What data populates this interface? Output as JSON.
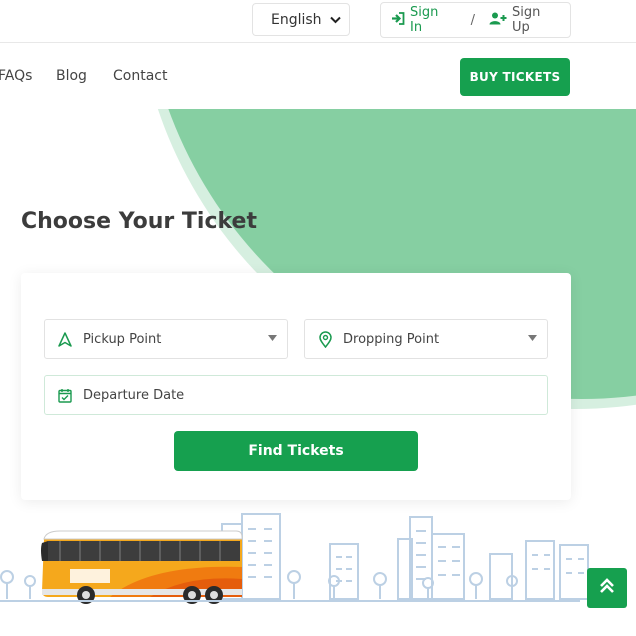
{
  "topbar": {
    "language": "English",
    "sign_in": "Sign In",
    "separator": "/",
    "sign_up": "Sign Up"
  },
  "nav": {
    "links": [
      "FAQs",
      "Blog",
      "Contact"
    ],
    "buy_tickets": "BUY TICKETS"
  },
  "hero": {
    "title": "Choose Your Ticket"
  },
  "search": {
    "pickup_placeholder": "Pickup Point",
    "dropping_placeholder": "Dropping Point",
    "date_placeholder": "Departure Date",
    "find_button": "Find Tickets"
  },
  "colors": {
    "primary": "#16a04f",
    "blob": "#86cfa2",
    "city_line": "#bcd0e4"
  },
  "icons": {
    "sign_in": "sign-in-icon",
    "sign_up": "user-plus-icon",
    "pickup": "navigation-arrow-icon",
    "dropping": "map-pin-icon",
    "date": "calendar-check-icon",
    "scroll_top": "double-chevron-up-icon"
  }
}
